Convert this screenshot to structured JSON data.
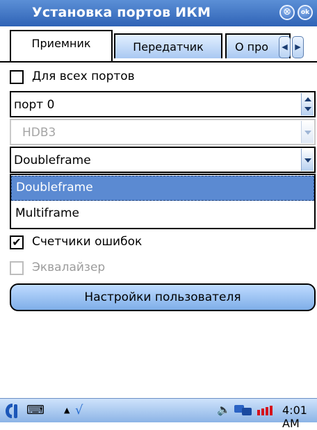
{
  "window": {
    "title": "Установка портов ИКМ",
    "close_glyph": "⊗",
    "ok_label": "ok"
  },
  "tabs": [
    {
      "label": "Приемник",
      "active": true
    },
    {
      "label": "Передатчик",
      "active": false
    },
    {
      "label": "О про",
      "active": false
    }
  ],
  "tab_scroll": {
    "left_icon": "chevron-left-icon",
    "right_icon": "chevron-right-icon",
    "left_glyph": "◀",
    "right_glyph": "▶"
  },
  "form": {
    "all_ports": {
      "label": "Для всех портов",
      "checked": false
    },
    "port_spinner": {
      "value": "порт 0"
    },
    "line_code": {
      "value": "HDB3",
      "disabled": true
    },
    "frame": {
      "value": "Doubleframe",
      "options": [
        "Doubleframe",
        "Multiframe"
      ],
      "highlighted": "Doubleframe"
    },
    "error_counters": {
      "label": "Счетчики ошибок",
      "checked": true,
      "mark": "✔"
    },
    "equalizer": {
      "label": "Эквалайзер",
      "checked": false,
      "disabled": true
    },
    "user_settings_button": "Настройки пользователя"
  },
  "taskbar": {
    "time": "4:01 AM",
    "kb_glyph": "⌨",
    "up_glyph": "▲",
    "check_glyph": "√",
    "speaker_glyph": "🔈",
    "icons": [
      "start-logo-icon",
      "keyboard-icon",
      "up-arrow-icon",
      "pen-check-icon",
      "speaker-icon",
      "network-icon",
      "battery-icon"
    ]
  },
  "colors": {
    "titlebar": "#2f63b6",
    "selection": "#5b8ad2",
    "button": "#7eaee8"
  }
}
